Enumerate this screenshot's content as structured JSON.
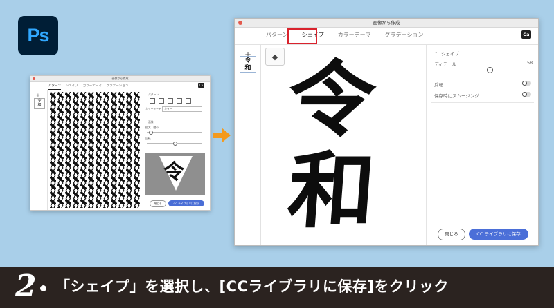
{
  "app": {
    "logo_text": "Ps"
  },
  "small_window": {
    "title": "画像から作成",
    "tabs": [
      "パターン",
      "シェイプ",
      "カラーテーマ",
      "グラデーション"
    ],
    "ca_badge": "Ca",
    "section_pattern": "パターン",
    "color_mode_label": "カラーモード",
    "color_mode_value": "カラー",
    "section_image": "画像",
    "size_label": "拡大・縮小",
    "rotate_label": "回転",
    "close_label": "閉じる",
    "save_label": "CC ライブラリに保存"
  },
  "big_window": {
    "title": "画像から作成",
    "tabs": [
      {
        "label": "パターン",
        "active": false
      },
      {
        "label": "シェイプ",
        "active": true
      },
      {
        "label": "カラーテーマ",
        "active": false
      },
      {
        "label": "グラデーション",
        "active": false
      }
    ],
    "ca_badge": "Ca",
    "thumb_text": "令和",
    "canvas_char_1": "令",
    "canvas_char_2": "和",
    "settings": {
      "section_title": "シェイプ",
      "detail_label": "ディテール",
      "detail_value": "58",
      "invert_label": "反転",
      "smoothing_label": "保存時にスムージング"
    },
    "close_label": "閉じる",
    "save_label": "CC ライブラリに保存"
  },
  "caption": {
    "step_number": "2",
    "text": "「シェイプ」を選択し、[CCライブラリに保存]をクリック"
  },
  "colors": {
    "background": "#a9cfe9",
    "arrow": "#f39a1e",
    "highlight_box": "#d9232d",
    "primary_button": "#4b6fd8",
    "caption_bar": "#2b2320"
  }
}
